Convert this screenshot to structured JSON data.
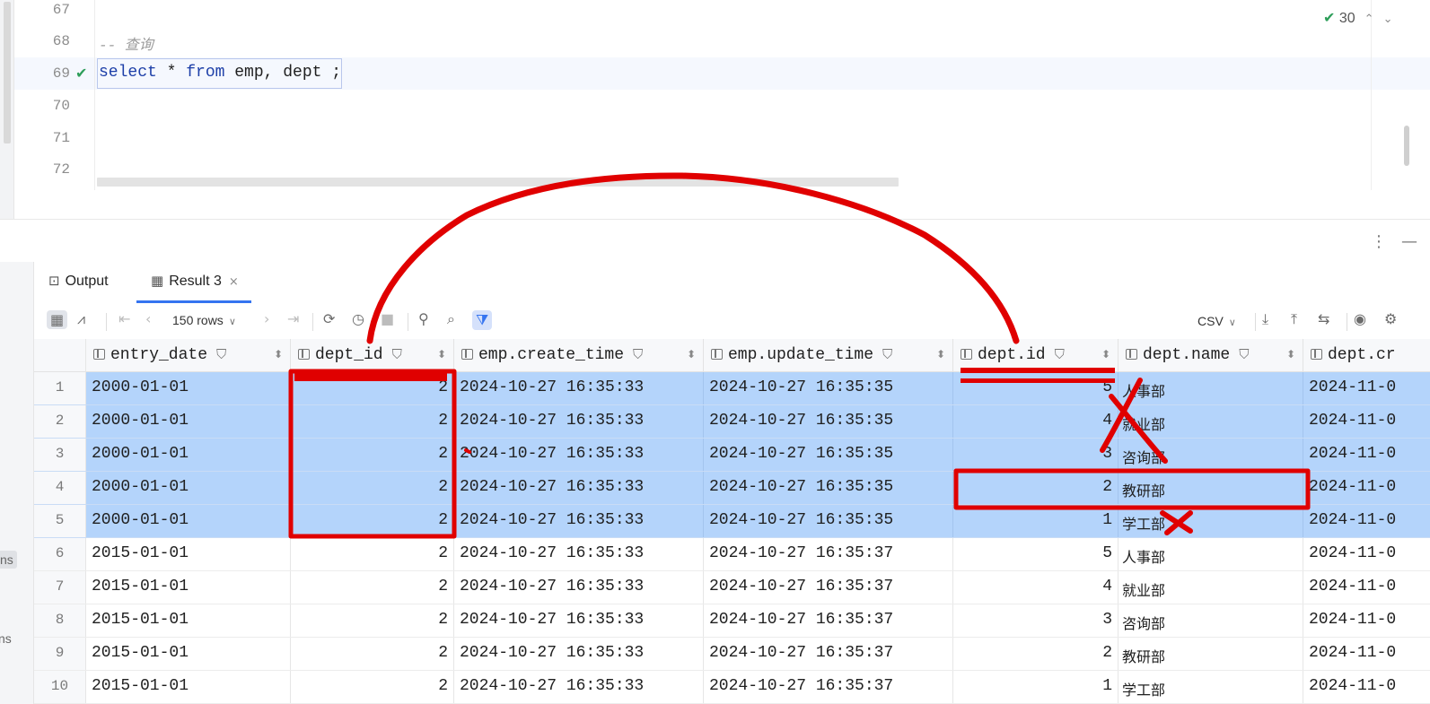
{
  "editor": {
    "lines": [
      {
        "num": "67",
        "text": ""
      },
      {
        "num": "68",
        "text": "-- 查询"
      },
      {
        "num": "69",
        "text": "select * from emp, dept ;"
      },
      {
        "num": "70",
        "text": ""
      },
      {
        "num": "71",
        "text": ""
      },
      {
        "num": "72",
        "text": ""
      }
    ],
    "sql": {
      "kw1": "select",
      "star": " * ",
      "kw2": "from",
      "rest": " emp, dept",
      "tail": " ;"
    },
    "inspections_count": "30"
  },
  "services_labels": [
    "ns",
    "ns"
  ],
  "tabs": [
    {
      "label": "Output",
      "icon": "console-icon"
    },
    {
      "label": "Result 3",
      "icon": "table-icon",
      "active": true,
      "close": "×"
    }
  ],
  "toolbar": {
    "rows_label": "150 rows",
    "export_format": "CSV"
  },
  "grid": {
    "columns": [
      "entry_date",
      "dept_id",
      "emp.create_time",
      "emp.update_time",
      "dept.id",
      "dept.name",
      "dept.cr"
    ],
    "rows": [
      {
        "n": "1",
        "entry_date": "2000-01-01",
        "dept_id": "2",
        "create": "2024-10-27 16:35:33",
        "update": "2024-10-27 16:35:35",
        "did": "5",
        "dname": "人事部",
        "dcr": "2024-11-0",
        "selected": true
      },
      {
        "n": "2",
        "entry_date": "2000-01-01",
        "dept_id": "2",
        "create": "2024-10-27 16:35:33",
        "update": "2024-10-27 16:35:35",
        "did": "4",
        "dname": "就业部",
        "dcr": "2024-11-0",
        "selected": true
      },
      {
        "n": "3",
        "entry_date": "2000-01-01",
        "dept_id": "2",
        "create": "2024-10-27 16:35:33",
        "update": "2024-10-27 16:35:35",
        "did": "3",
        "dname": "咨询部",
        "dcr": "2024-11-0",
        "selected": true
      },
      {
        "n": "4",
        "entry_date": "2000-01-01",
        "dept_id": "2",
        "create": "2024-10-27 16:35:33",
        "update": "2024-10-27 16:35:35",
        "did": "2",
        "dname": "教研部",
        "dcr": "2024-11-0",
        "selected": true
      },
      {
        "n": "5",
        "entry_date": "2000-01-01",
        "dept_id": "2",
        "create": "2024-10-27 16:35:33",
        "update": "2024-10-27 16:35:35",
        "did": "1",
        "dname": "学工部",
        "dcr": "2024-11-0",
        "selected": true
      },
      {
        "n": "6",
        "entry_date": "2015-01-01",
        "dept_id": "2",
        "create": "2024-10-27 16:35:33",
        "update": "2024-10-27 16:35:37",
        "did": "5",
        "dname": "人事部",
        "dcr": "2024-11-0",
        "selected": false
      },
      {
        "n": "7",
        "entry_date": "2015-01-01",
        "dept_id": "2",
        "create": "2024-10-27 16:35:33",
        "update": "2024-10-27 16:35:37",
        "did": "4",
        "dname": "就业部",
        "dcr": "2024-11-0",
        "selected": false
      },
      {
        "n": "8",
        "entry_date": "2015-01-01",
        "dept_id": "2",
        "create": "2024-10-27 16:35:33",
        "update": "2024-10-27 16:35:37",
        "did": "3",
        "dname": "咨询部",
        "dcr": "2024-11-0",
        "selected": false
      },
      {
        "n": "9",
        "entry_date": "2015-01-01",
        "dept_id": "2",
        "create": "2024-10-27 16:35:33",
        "update": "2024-10-27 16:35:37",
        "did": "2",
        "dname": "教研部",
        "dcr": "2024-11-0",
        "selected": false
      },
      {
        "n": "10",
        "entry_date": "2015-01-01",
        "dept_id": "2",
        "create": "2024-10-27 16:35:33",
        "update": "2024-10-27 16:35:37",
        "did": "1",
        "dname": "学工部",
        "dcr": "2024-11-0",
        "selected": false
      }
    ]
  },
  "colors": {
    "selection": "#b4d4fb",
    "annotation": "#e00000",
    "keyword": "#1d3fa8",
    "accent": "#3574f0"
  }
}
